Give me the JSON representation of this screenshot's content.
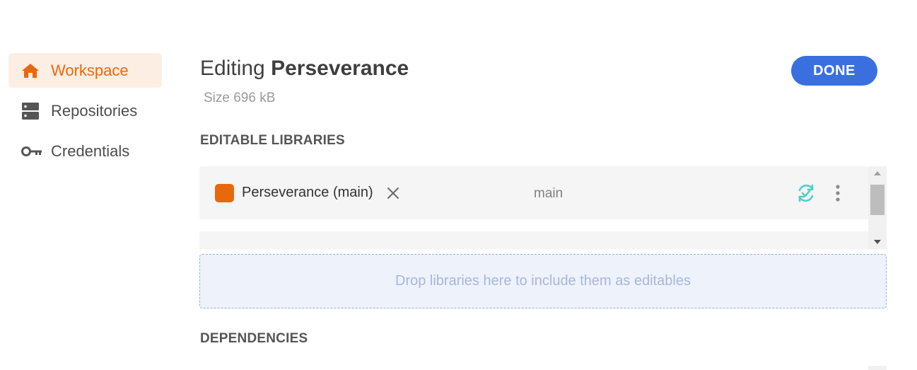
{
  "sidebar": {
    "items": [
      {
        "label": "Workspace",
        "icon": "home-icon",
        "active": true
      },
      {
        "label": "Repositories",
        "icon": "server-icon",
        "active": false
      },
      {
        "label": "Credentials",
        "icon": "key-icon",
        "active": false
      }
    ]
  },
  "header": {
    "title_prefix": "Editing",
    "title_name": "Perseverance",
    "size": "Size 696 kB",
    "done_label": "DONE"
  },
  "sections": {
    "editable": "EDITABLE LIBRARIES",
    "dependencies": "DEPENDENCIES"
  },
  "libraries": [
    {
      "name": "Perseverance (main)",
      "branch": "main",
      "color": "#e8690c"
    },
    {
      "name": "",
      "branch": "",
      "color": "#e8690c"
    }
  ],
  "dropzone": {
    "text": "Drop libraries here to include them as editables"
  },
  "colors": {
    "accent": "#e8690c",
    "accent_bg": "#fdeee3",
    "primary": "#3a6fe0",
    "sync": "#4fd1c5"
  }
}
